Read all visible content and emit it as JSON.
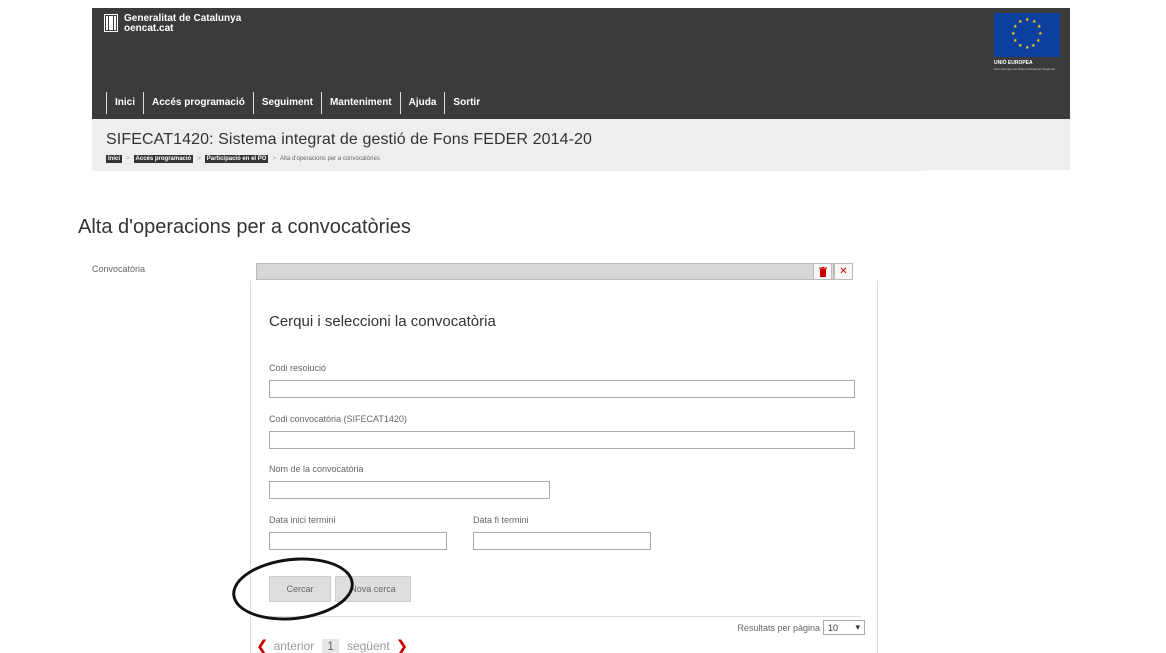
{
  "header": {
    "logo_line1": "Generalitat de Catalunya",
    "logo_line2": "oencat.cat",
    "eu_label": "UNIÓ EUROPEA",
    "eu_sub": "Fons Europeu de Desenvolupament Regional",
    "nav": [
      "Inici",
      "Accés programació",
      "Seguiment",
      "Manteniment",
      "Ajuda",
      "Sortir"
    ]
  },
  "system_title": "SIFECAT1420: Sistema integrat de gestió de Fons FEDER 2014-20",
  "breadcrumb": {
    "items": [
      "Inici",
      "Accés programació",
      "Participació en el PO"
    ],
    "current": "Alta d'operacions per a convocatòries"
  },
  "page_title": "Alta d'operacions per a convocatòries",
  "convocatoria_label": "Convocatòria",
  "popup": {
    "title": "Cerqui i seleccioni la convocatòria",
    "fields": {
      "codi_resolucio": "Codi resolució",
      "codi_convocatoria": "Codi convocatòria (SIFECAT1420)",
      "nom_convocatoria": "Nom de la convocatòria",
      "data_inici": "Data inici termini",
      "data_fi": "Data fi termini"
    },
    "buttons": {
      "search": "Cercar",
      "new_search": "Nova cerca"
    },
    "results_per_page_label": "Resultats per pàgina",
    "results_per_page_value": "10"
  },
  "pager": {
    "prev": "anterior",
    "page": "1",
    "next": "següent"
  },
  "colors": {
    "header_bg": "#3b3b3b",
    "subbar_bg": "#eeeeee",
    "accent_red": "#cc0000",
    "eu_blue": "#0d3f9e"
  }
}
